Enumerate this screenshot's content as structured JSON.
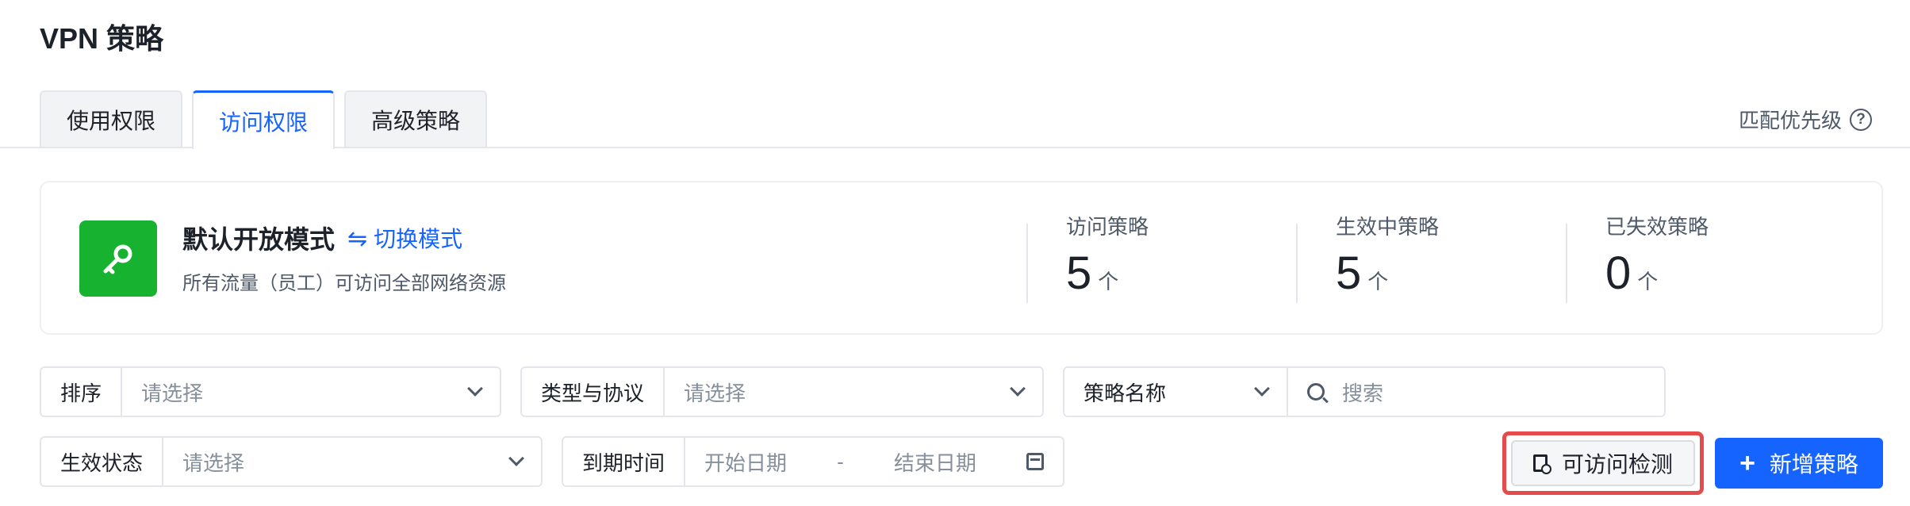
{
  "page": {
    "title": "VPN 策略"
  },
  "tabs": [
    {
      "label": "使用权限",
      "active": false
    },
    {
      "label": "访问权限",
      "active": true
    },
    {
      "label": "高级策略",
      "active": false
    }
  ],
  "priority": {
    "label": "匹配优先级",
    "icon": "help-circle-icon"
  },
  "mode": {
    "title": "默认开放模式",
    "switch_label": "切换模式",
    "description": "所有流量（员工）可访问全部网络资源",
    "icon": "key-icon",
    "icon_color": "#18b231"
  },
  "stats": [
    {
      "label": "访问策略",
      "value": "5",
      "unit": "个"
    },
    {
      "label": "生效中策略",
      "value": "5",
      "unit": "个"
    },
    {
      "label": "已失效策略",
      "value": "0",
      "unit": "个"
    }
  ],
  "filters": {
    "sort": {
      "label": "排序",
      "placeholder": "请选择"
    },
    "type_protocol": {
      "label": "类型与协议",
      "placeholder": "请选择"
    },
    "policy_name": {
      "label": "策略名称",
      "placeholder": "搜索"
    },
    "status": {
      "label": "生效状态",
      "placeholder": "请选择"
    },
    "expiry": {
      "label": "到期时间",
      "start_placeholder": "开始日期",
      "separator": "-",
      "end_placeholder": "结束日期"
    }
  },
  "actions": {
    "check_label": "可访问检测",
    "add_label": "新增策略",
    "add_plus": "+"
  },
  "colors": {
    "primary": "#1664ff",
    "highlight_border": "#e54b4b"
  }
}
